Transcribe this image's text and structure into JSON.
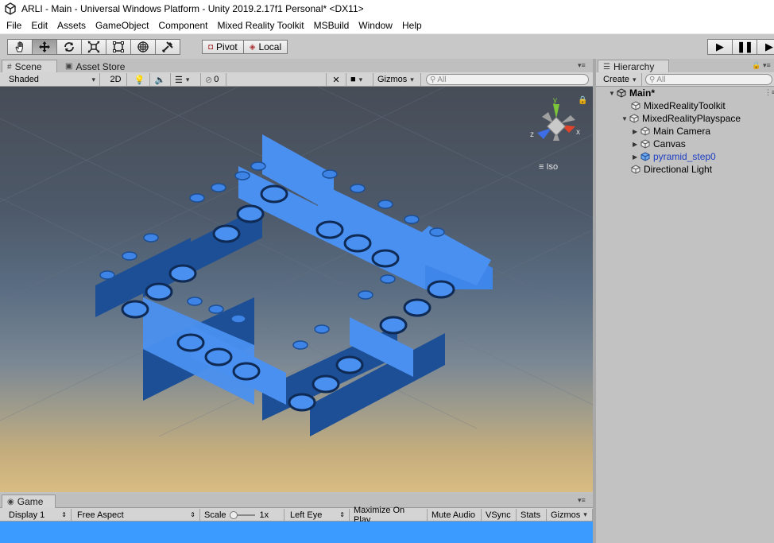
{
  "window": {
    "title": "ARLI - Main - Universal Windows Platform - Unity 2019.2.17f1 Personal* <DX11>"
  },
  "menu": [
    "File",
    "Edit",
    "Assets",
    "GameObject",
    "Component",
    "Mixed Reality Toolkit",
    "MSBuild",
    "Window",
    "Help"
  ],
  "toolbar": {
    "tools": [
      "hand-tool-icon",
      "move-tool-icon",
      "rotate-tool-icon",
      "scale-tool-icon",
      "rect-tool-icon",
      "transform-tool-icon",
      "custom-tool-icon"
    ],
    "pivot_label": "Pivot",
    "local_label": "Local"
  },
  "scene": {
    "tabs": {
      "scene": "Scene",
      "asset_store": "Asset Store"
    },
    "shading": "Shaded",
    "mode_2d": "2D",
    "hidden_count": "0",
    "gizmos": "Gizmos",
    "search_placeholder": "All",
    "projection": "Iso",
    "axis_labels": {
      "x": "x",
      "y": "y",
      "z": "z"
    }
  },
  "hierarchy": {
    "tab": "Hierarchy",
    "create": "Create",
    "search_placeholder": "All",
    "scene_name": "Main*",
    "items": [
      {
        "label": "MixedRealityToolkit"
      },
      {
        "label": "MixedRealityPlayspace"
      },
      {
        "label": "Main Camera"
      },
      {
        "label": "Canvas"
      },
      {
        "label": "pyramid_step0"
      },
      {
        "label": "Directional Light"
      }
    ]
  },
  "game": {
    "tab": "Game",
    "display": "Display 1",
    "aspect": "Free Aspect",
    "scale_label": "Scale",
    "scale_value": "1x",
    "eye": "Left Eye",
    "maximize": "Maximize On Play",
    "mute": "Mute Audio",
    "vsync": "VSync",
    "stats": "Stats",
    "gizmos": "Gizmos"
  },
  "colors": {
    "model_light": "#4a90f0",
    "model_dark": "#1d4f96",
    "game_bg": "#3c9bff",
    "link_blue": "#1d3ec2"
  }
}
